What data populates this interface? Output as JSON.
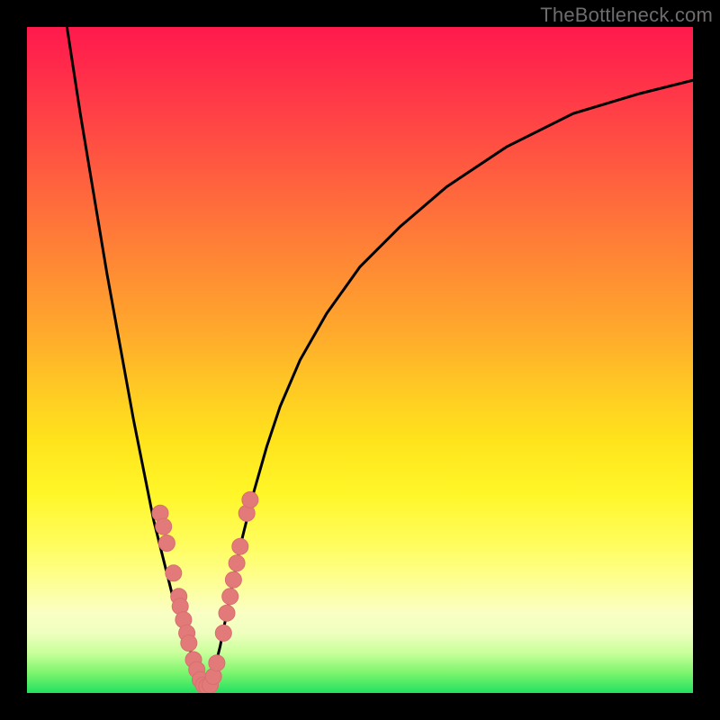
{
  "watermark": "TheBottleneck.com",
  "colors": {
    "frame": "#000000",
    "curve": "#000000",
    "marker_fill": "#e27a7a",
    "marker_stroke": "#d86f6f"
  },
  "chart_data": {
    "type": "line",
    "title": "",
    "xlabel": "",
    "ylabel": "",
    "xlim": [
      0,
      100
    ],
    "ylim": [
      0,
      100
    ],
    "note": "No axis labels or tick labels are shown; values are estimated from pixel positions on a 0–100 scale.",
    "series": [
      {
        "name": "bottleneck-curve-left",
        "x": [
          6,
          8,
          10,
          12,
          14,
          16,
          18,
          19,
          20,
          21,
          22,
          23,
          24,
          25,
          26,
          27
        ],
        "y": [
          100,
          87,
          75,
          63,
          52,
          41,
          31,
          26,
          22,
          18,
          14,
          11,
          8,
          5,
          3,
          1
        ]
      },
      {
        "name": "bottleneck-curve-right",
        "x": [
          27,
          28,
          29,
          30,
          31,
          32,
          34,
          36,
          38,
          41,
          45,
          50,
          56,
          63,
          72,
          82,
          92,
          100
        ],
        "y": [
          1,
          3,
          7,
          12,
          17,
          22,
          30,
          37,
          43,
          50,
          57,
          64,
          70,
          76,
          82,
          87,
          90,
          92
        ]
      }
    ],
    "markers": {
      "name": "highlighted-points",
      "points": [
        {
          "x": 20.0,
          "y": 27.0
        },
        {
          "x": 20.5,
          "y": 25.0
        },
        {
          "x": 21.0,
          "y": 22.5
        },
        {
          "x": 22.0,
          "y": 18.0
        },
        {
          "x": 22.8,
          "y": 14.5
        },
        {
          "x": 23.0,
          "y": 13.0
        },
        {
          "x": 23.5,
          "y": 11.0
        },
        {
          "x": 24.0,
          "y": 9.0
        },
        {
          "x": 24.3,
          "y": 7.5
        },
        {
          "x": 25.0,
          "y": 5.0
        },
        {
          "x": 25.5,
          "y": 3.5
        },
        {
          "x": 26.0,
          "y": 2.0
        },
        {
          "x": 26.5,
          "y": 1.2
        },
        {
          "x": 27.0,
          "y": 1.0
        },
        {
          "x": 27.5,
          "y": 1.2
        },
        {
          "x": 28.0,
          "y": 2.5
        },
        {
          "x": 28.5,
          "y": 4.5
        },
        {
          "x": 29.5,
          "y": 9.0
        },
        {
          "x": 30.0,
          "y": 12.0
        },
        {
          "x": 30.5,
          "y": 14.5
        },
        {
          "x": 31.0,
          "y": 17.0
        },
        {
          "x": 31.5,
          "y": 19.5
        },
        {
          "x": 32.0,
          "y": 22.0
        },
        {
          "x": 33.0,
          "y": 27.0
        },
        {
          "x": 33.5,
          "y": 29.0
        }
      ]
    }
  }
}
